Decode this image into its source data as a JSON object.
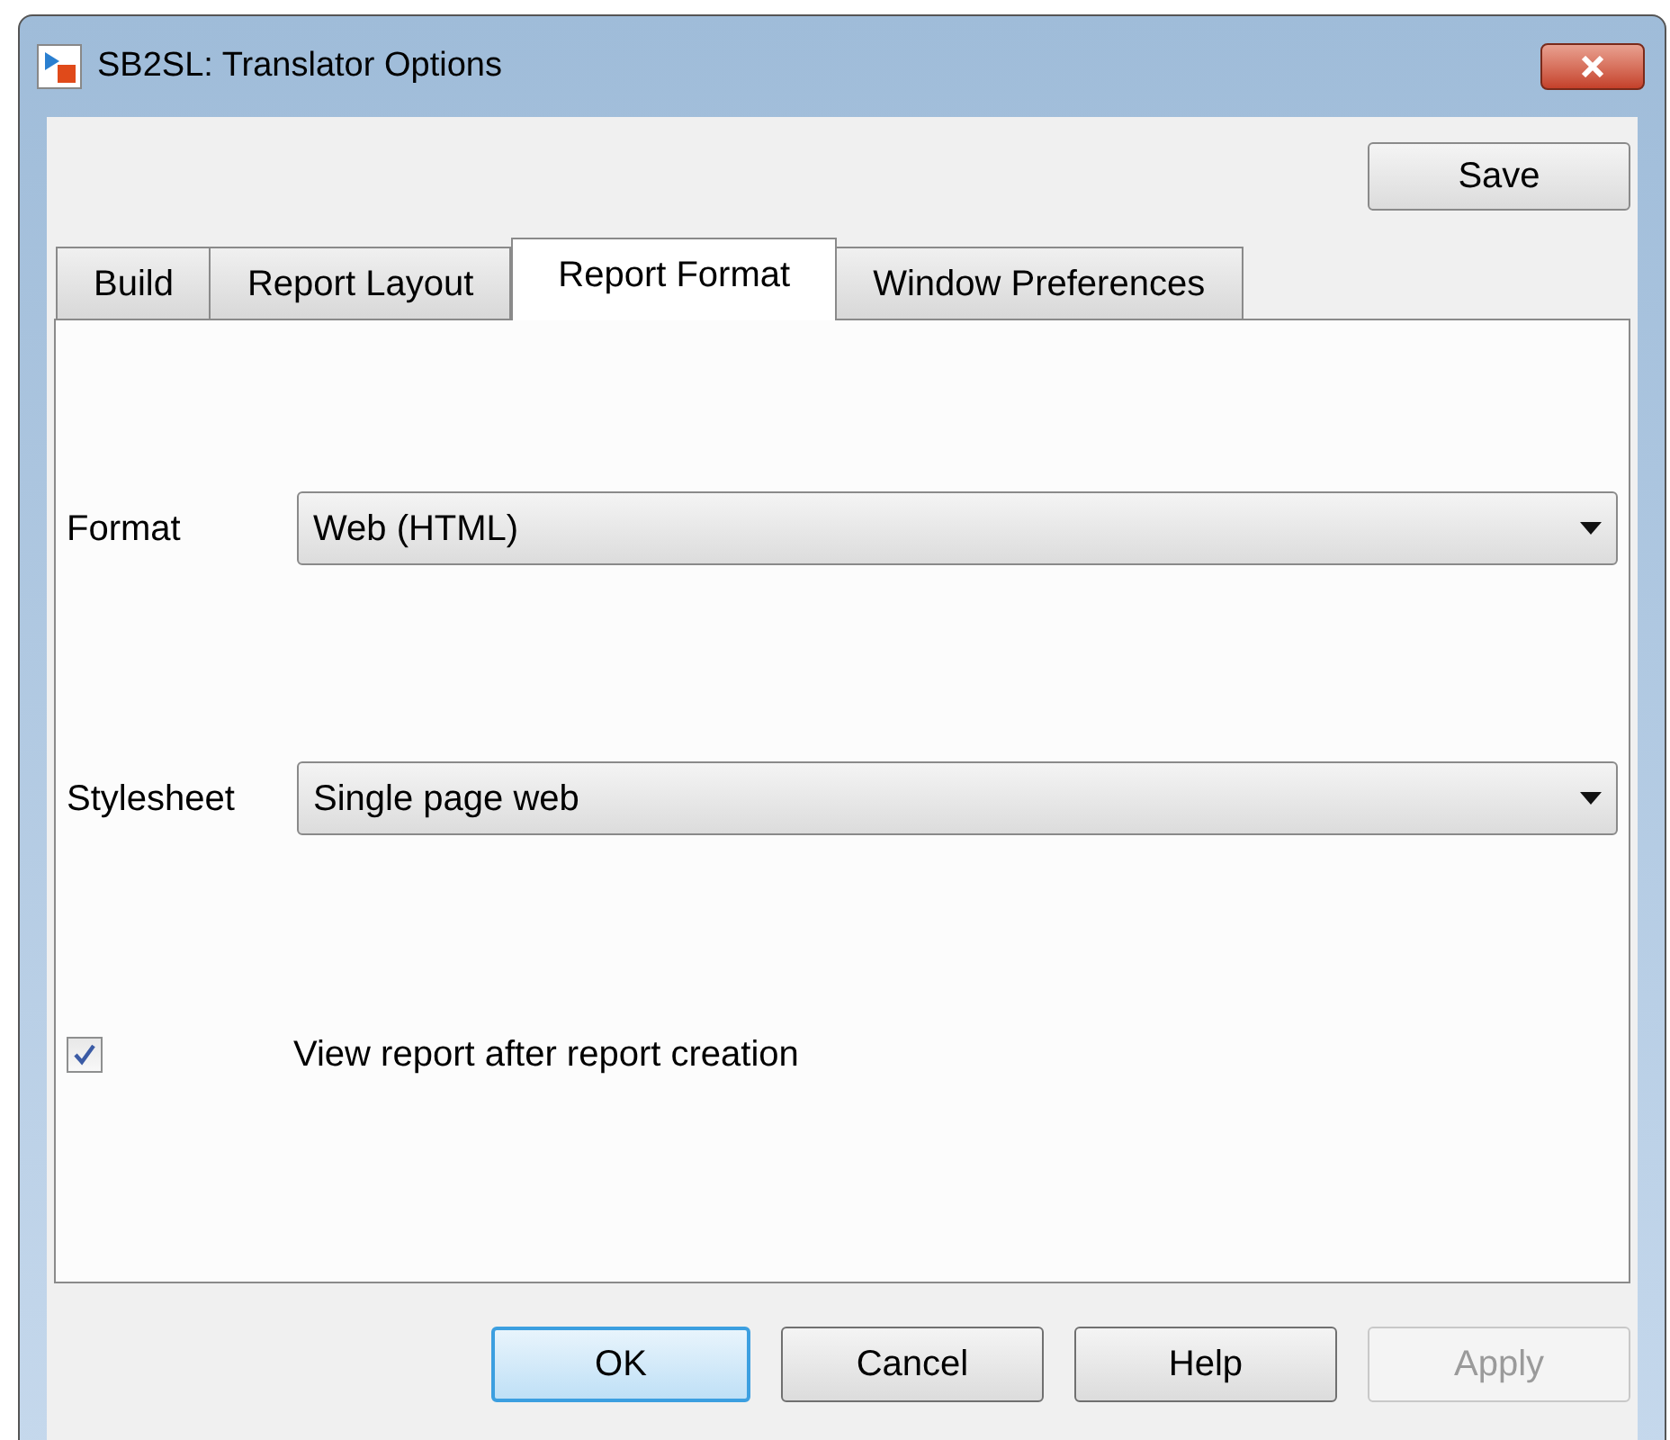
{
  "window": {
    "title": "SB2SL: Translator Options"
  },
  "save_button": {
    "label": "Save"
  },
  "tabs": [
    {
      "label": "Build",
      "selected": false
    },
    {
      "label": "Report Layout",
      "selected": false
    },
    {
      "label": "Report Format",
      "selected": true
    },
    {
      "label": "Window Preferences",
      "selected": false
    }
  ],
  "fields": [
    {
      "label": "Format",
      "value": "Web (HTML)"
    },
    {
      "label": "Stylesheet",
      "value": "Single page web"
    }
  ],
  "checkbox": {
    "label": "View report after report creation",
    "checked": true
  },
  "buttons": [
    {
      "label": "OK",
      "default": true,
      "disabled": false
    },
    {
      "label": "Cancel",
      "default": false,
      "disabled": false
    },
    {
      "label": "Help",
      "default": false,
      "disabled": false
    },
    {
      "label": "Apply",
      "default": false,
      "disabled": true
    }
  ]
}
